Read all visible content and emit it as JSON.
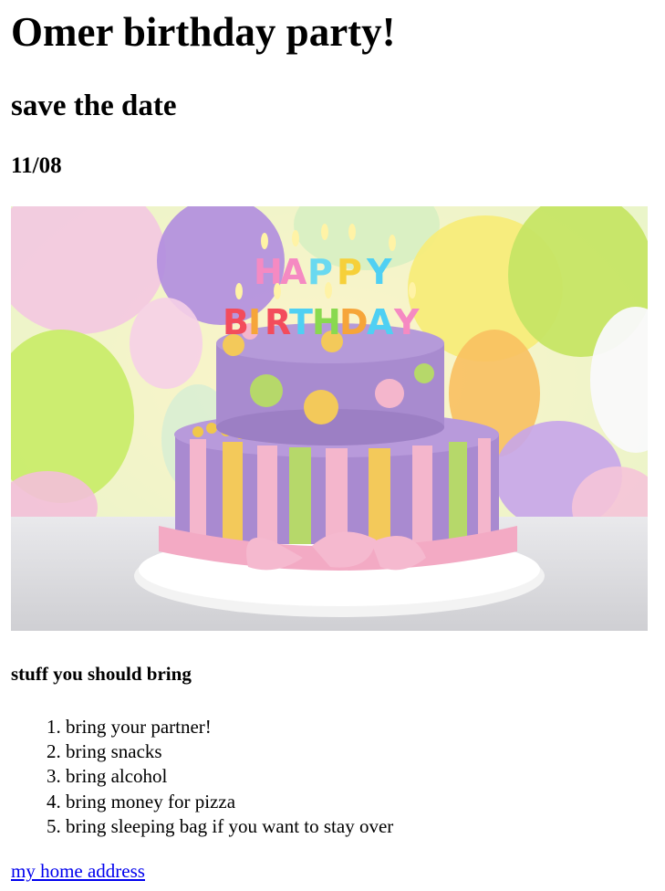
{
  "title": "Omer birthday party!",
  "subtitle": "save the date",
  "date": "11/08",
  "image": {
    "icon": "birthday-cake-photo",
    "candle_text": "HAPPY BIRTHDAY",
    "colors": {
      "purple": "#a98ad0",
      "pink": "#f4b6cc",
      "yellow": "#f3c95a",
      "green": "#b6d86a"
    }
  },
  "bring_heading": "stuff you should bring",
  "bring_items": [
    "bring your partner!",
    "bring snacks",
    "bring alcohol",
    "bring money for pizza",
    "bring sleeping bag if you want to stay over"
  ],
  "address_link": "my home address"
}
